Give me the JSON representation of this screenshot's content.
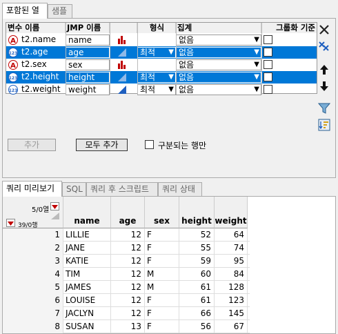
{
  "top_tabs": [
    {
      "label": "포함된 열"
    },
    {
      "label": "샘플"
    }
  ],
  "headers": {
    "var_name": "변수 이름",
    "jmp_name": "JMP 이름",
    "format": "형식",
    "aggregate": "집계",
    "group_by": "그룹화 기준"
  },
  "rows": [
    {
      "var_name": "t2.name",
      "jmp_name": "name",
      "type": "char",
      "format": "",
      "aggregate": "없음",
      "selected": false
    },
    {
      "var_name": "t2.age",
      "jmp_name": "age",
      "type": "num",
      "format": "최적",
      "aggregate": "없음",
      "selected": true
    },
    {
      "var_name": "t2.sex",
      "jmp_name": "sex",
      "type": "char",
      "format": "",
      "aggregate": "없음",
      "selected": false
    },
    {
      "var_name": "t2.height",
      "jmp_name": "height",
      "type": "num",
      "format": "최적",
      "aggregate": "없음",
      "selected": true
    },
    {
      "var_name": "t2.weight",
      "jmp_name": "weight",
      "type": "num",
      "format": "최적",
      "aggregate": "없음",
      "selected": false
    }
  ],
  "buttons": {
    "add": "추가",
    "add_all": "모두 추가",
    "distinct_label": "구분되는 행만"
  },
  "bottom_tabs": [
    {
      "label": "쿼리 미리보기"
    },
    {
      "label": "SQL"
    },
    {
      "label": "쿼리 후 스크립트"
    },
    {
      "label": "쿼리 상태"
    }
  ],
  "table": {
    "cols_count": "5/0열",
    "rows_count": "39/0행",
    "columns": [
      "name",
      "age",
      "sex",
      "height",
      "weight"
    ],
    "data": [
      [
        "1",
        "LILLIE",
        "12",
        "F",
        "52",
        "64"
      ],
      [
        "2",
        "JANE",
        "12",
        "F",
        "55",
        "74"
      ],
      [
        "3",
        "KATIE",
        "12",
        "F",
        "59",
        "95"
      ],
      [
        "4",
        "TIM",
        "12",
        "M",
        "60",
        "84"
      ],
      [
        "5",
        "JAMES",
        "12",
        "M",
        "61",
        "128"
      ],
      [
        "6",
        "LOUISE",
        "12",
        "F",
        "61",
        "123"
      ],
      [
        "7",
        "JACLYN",
        "12",
        "F",
        "66",
        "145"
      ],
      [
        "8",
        "SUSAN",
        "13",
        "F",
        "56",
        "67"
      ]
    ]
  },
  "colors": {
    "selection": "#0078d7",
    "red_icon": "#c00000",
    "blue_icon": "#1f5fbf"
  }
}
